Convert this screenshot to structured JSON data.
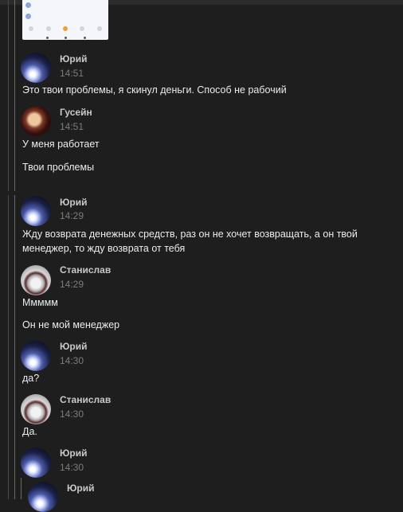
{
  "thread": {
    "messages": [
      {
        "author": "Юрий",
        "time": "14:51"
      },
      {
        "author": "Гусейн",
        "time": "14:51"
      },
      {
        "author": "Юрий",
        "time": "14:29"
      },
      {
        "author": "Станислав",
        "time": "14:29"
      },
      {
        "author": "Юрий",
        "time": "14:30"
      },
      {
        "author": "Станислав",
        "time": "14:30"
      },
      {
        "author": "Юрий",
        "time": "14:30"
      },
      {
        "author": "Юрий"
      }
    ],
    "texts": [
      "Это твои проблемы, я скинул деньги. Способ не рабочий",
      "У меня работает",
      "Твои проблемы",
      "Жду возврата денежных средств, раз он не хочет возвращать, а он твой",
      "менеджер, то жду возврата от тебя",
      "Ммммм",
      "Он не мой менеджер",
      "да?",
      "Да."
    ]
  },
  "colors": {
    "background": "#1e1e1e",
    "text": "#ececec",
    "author": "#c8c8c8",
    "timestamp": "#7c7c7c",
    "accent_orange": "#f0a030"
  }
}
